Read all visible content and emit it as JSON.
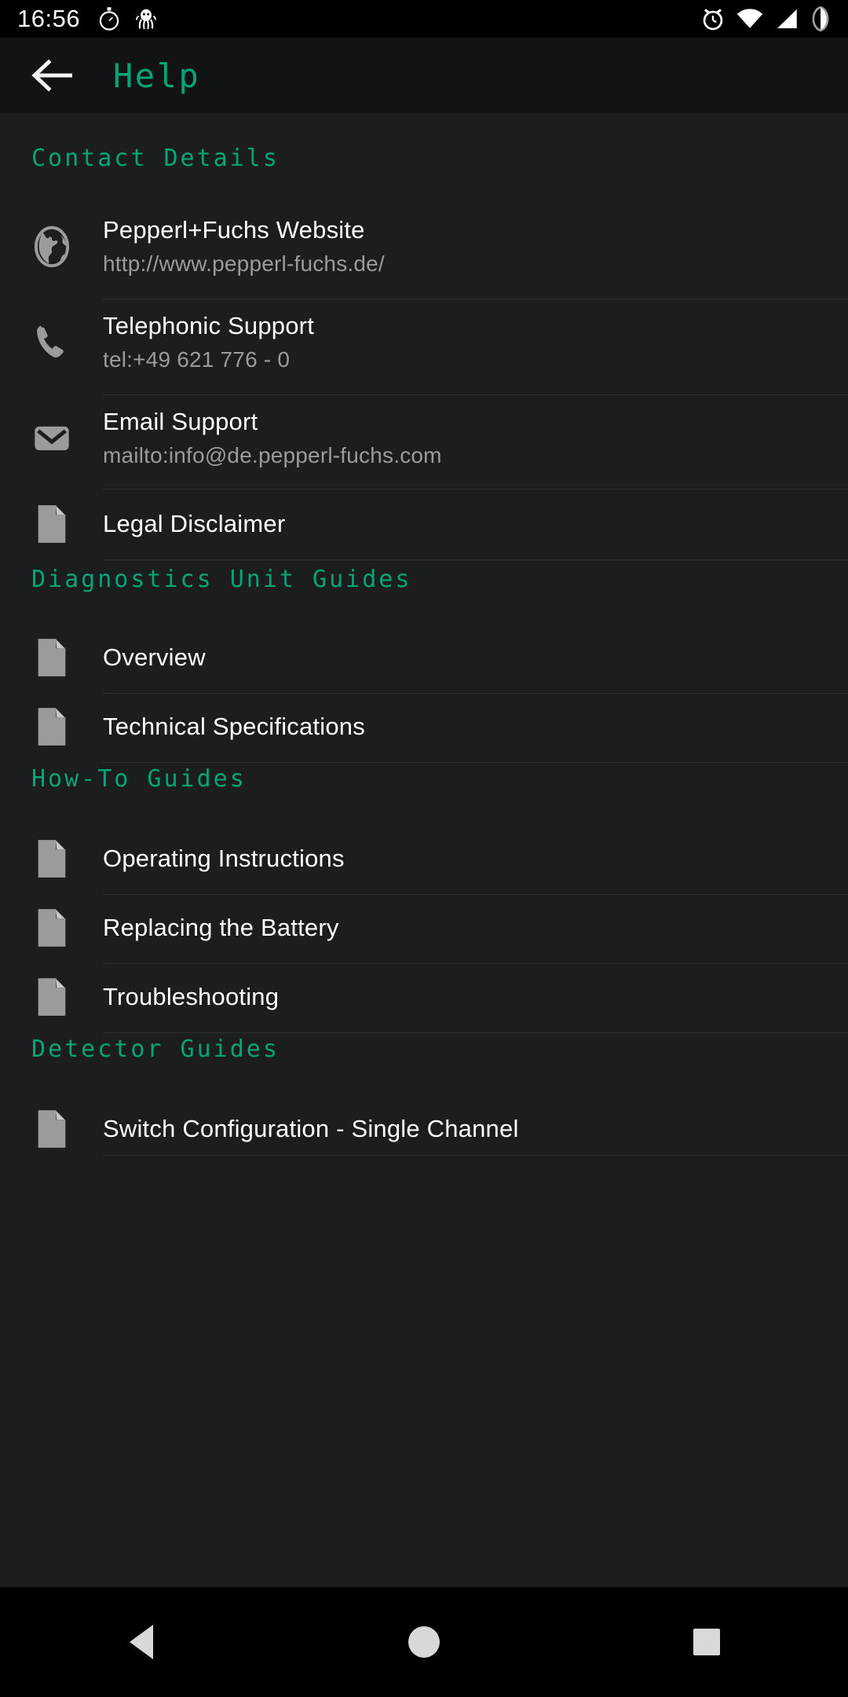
{
  "theme": {
    "accent": "#00a578",
    "background": "#1b1d1e",
    "appbar_background": "#111314",
    "statusbar_background": "#000000",
    "title_text": "#ffffff",
    "subtitle_text": "#9b9b9b",
    "divider": "#2e3132",
    "icon_gray": "#9b9b9b"
  },
  "statusbar": {
    "time": "16:56",
    "left_icons": [
      "stopwatch-icon",
      "octopus-icon"
    ],
    "right_icons": [
      "alarm-clock-icon",
      "wifi-icon",
      "cell-signal-icon",
      "battery-icon"
    ]
  },
  "appbar": {
    "back_icon": "arrow-left-icon",
    "title": "Help"
  },
  "sections": [
    {
      "label": "Contact Details",
      "items": [
        {
          "icon": "globe-icon",
          "title": "Pepperl+Fuchs Website",
          "subtitle": "http://www.pepperl-fuchs.de/"
        },
        {
          "icon": "phone-icon",
          "title": "Telephonic Support",
          "subtitle": "tel:+49 621 776 - 0"
        },
        {
          "icon": "email-icon",
          "title": "Email Support",
          "subtitle": "mailto:info@de.pepperl-fuchs.com"
        },
        {
          "icon": "document-icon",
          "title": "Legal Disclaimer",
          "subtitle": ""
        }
      ]
    },
    {
      "label": "Diagnostics Unit Guides",
      "items": [
        {
          "icon": "document-icon",
          "title": "Overview",
          "subtitle": ""
        },
        {
          "icon": "document-icon",
          "title": "Technical Specifications",
          "subtitle": ""
        }
      ]
    },
    {
      "label": "How-To Guides",
      "items": [
        {
          "icon": "document-icon",
          "title": "Operating Instructions",
          "subtitle": ""
        },
        {
          "icon": "document-icon",
          "title": "Replacing the Battery",
          "subtitle": ""
        },
        {
          "icon": "document-icon",
          "title": "Troubleshooting",
          "subtitle": ""
        }
      ]
    },
    {
      "label": "Detector Guides",
      "items": [
        {
          "icon": "document-icon",
          "title": "Switch Configuration - Single Channel",
          "subtitle": ""
        }
      ]
    }
  ],
  "navbar": {
    "back_label": "back-triangle",
    "home_label": "home-circle",
    "recents_label": "recents-square"
  }
}
